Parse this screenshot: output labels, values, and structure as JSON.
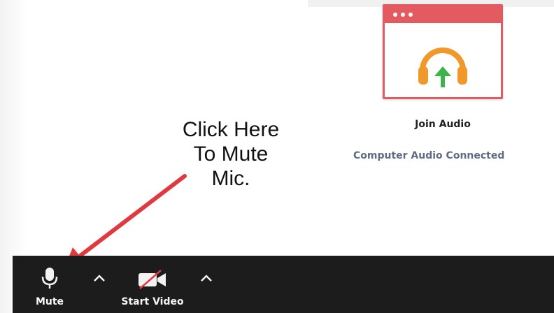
{
  "join_audio": {
    "label": "Join Audio",
    "status": "Computer Audio Connected",
    "icon": "headphones-icon",
    "colors": {
      "card_border": "#e35a60",
      "headphones": "#f0982a",
      "arrow": "#3cb44a"
    }
  },
  "annotation": {
    "lines": [
      "Click Here",
      "To Mute",
      "Mic."
    ],
    "arrow_color": "#e0393f"
  },
  "toolbar": {
    "mute_label": "Mute",
    "mute_icon": "microphone-icon",
    "start_video_label": "Start Video",
    "video_icon": "video-off-icon",
    "background": "#1c1c1c"
  }
}
